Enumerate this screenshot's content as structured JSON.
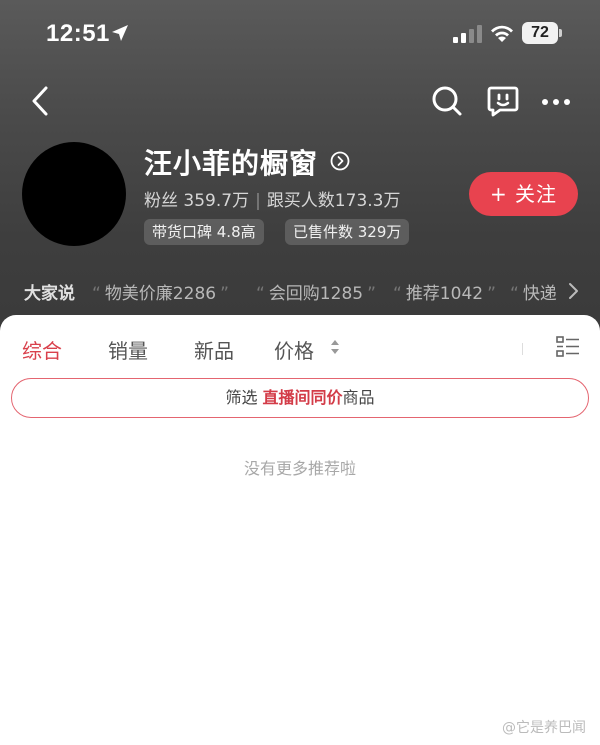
{
  "status_bar": {
    "time": "12:51",
    "battery": "72"
  },
  "nav": {
    "icons": [
      "back-arrow-icon",
      "search-icon",
      "message-icon",
      "more-icon"
    ]
  },
  "profile": {
    "shop_name": "汪小菲的橱窗",
    "fans_label": "粉丝 359.7万",
    "buyers_label": "跟买人数173.3万",
    "reputation_tag": "带货口碑 4.8高",
    "sold_tag": "已售件数 329万",
    "follow_button": "+ 关注"
  },
  "reviews": {
    "title": "大家说",
    "items": [
      "物美价廉2286",
      "会回购1285",
      "推荐1042",
      "快递"
    ]
  },
  "tabs": {
    "items": [
      "综合",
      "销量",
      "新品",
      "价格"
    ],
    "active": "综合"
  },
  "filter": {
    "prefix": "筛选 ",
    "highlight": "直播间同价",
    "suffix": "商品"
  },
  "empty_message": "没有更多推荐啦",
  "watermark": "它是养巴闻",
  "colors": {
    "accent": "#e8434f",
    "tab_active": "#d9414c",
    "header_bg": "#4a4a4a"
  }
}
